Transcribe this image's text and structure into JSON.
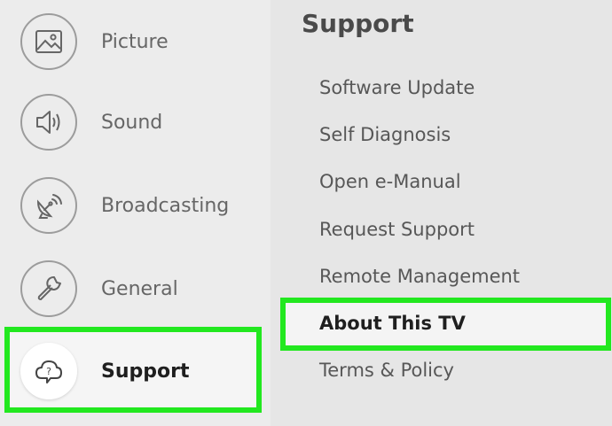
{
  "sidebar": {
    "items": [
      {
        "label": "Picture",
        "icon": "picture-icon"
      },
      {
        "label": "Sound",
        "icon": "sound-icon"
      },
      {
        "label": "Broadcasting",
        "icon": "broadcasting-icon"
      },
      {
        "label": "General",
        "icon": "wrench-icon"
      },
      {
        "label": "Support",
        "icon": "support-cloud-icon",
        "selected": true
      }
    ]
  },
  "panel": {
    "title": "Support",
    "options": [
      {
        "label": "Software Update"
      },
      {
        "label": "Self Diagnosis"
      },
      {
        "label": "Open e-Manual"
      },
      {
        "label": "Request Support"
      },
      {
        "label": "Remote Management"
      },
      {
        "label": "About This TV",
        "selected": true
      },
      {
        "label": "Terms & Policy"
      }
    ]
  },
  "colors": {
    "highlight": "#22e81f",
    "text": "#575757",
    "text_selected": "#1f1f1f"
  }
}
